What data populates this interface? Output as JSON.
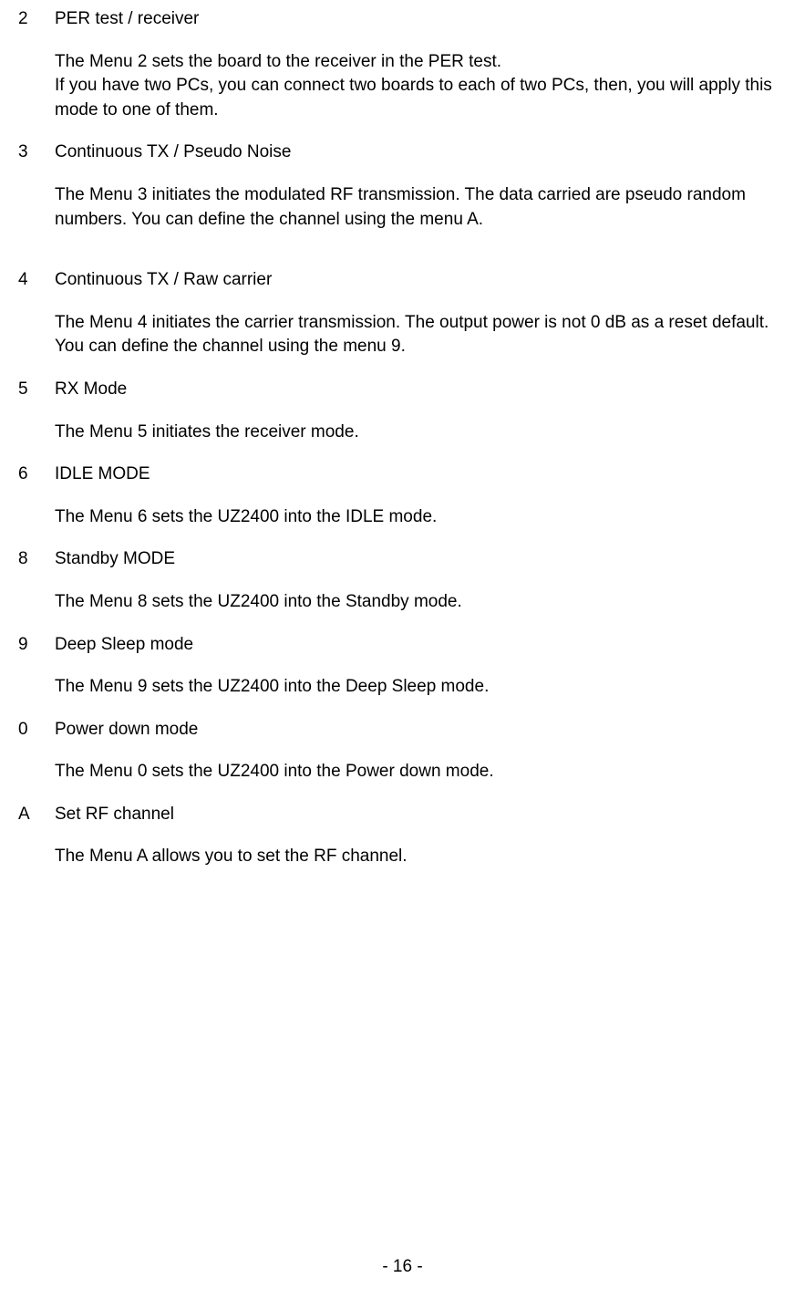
{
  "items": [
    {
      "num": "2",
      "title": "PER test / receiver",
      "desc": "The Menu 2 sets the board to the receiver in the PER test.\nIf you have two PCs, you can connect two boards to each of two PCs, then, you will apply this mode to one of them.",
      "extraGap": false
    },
    {
      "num": "3",
      "title": "Continuous TX / Pseudo Noise",
      "desc": "The Menu 3 initiates the modulated RF transmission. The data carried are pseudo random numbers. You can define the channel using the menu A.",
      "extraGap": true
    },
    {
      "num": "4",
      "title": "Continuous TX / Raw carrier",
      "desc": "The Menu 4 initiates the carrier transmission. The output power is not 0 dB as a reset default. You can define the channel using the menu 9.",
      "extraGap": false
    },
    {
      "num": "5",
      "title": "RX Mode",
      "desc": "The Menu 5 initiates the receiver mode.",
      "extraGap": false
    },
    {
      "num": "6",
      "title": "IDLE MODE",
      "desc": "The Menu 6 sets the UZ2400 into the IDLE mode.",
      "extraGap": false
    },
    {
      "num": "8",
      "title": "Standby MODE",
      "desc": "The Menu 8 sets the UZ2400 into the Standby mode.",
      "extraGap": false
    },
    {
      "num": "9",
      "title": "Deep Sleep mode",
      "desc": "The Menu 9 sets the UZ2400 into the Deep Sleep mode.",
      "extraGap": false
    },
    {
      "num": "0",
      "title": "Power down mode",
      "desc": "The Menu 0 sets the UZ2400 into the Power down mode.",
      "extraGap": false
    },
    {
      "num": "A",
      "title": "Set RF channel",
      "desc": "The Menu A allows you to set the RF channel.",
      "extraGap": false
    }
  ],
  "pageNumber": "- 16 -"
}
